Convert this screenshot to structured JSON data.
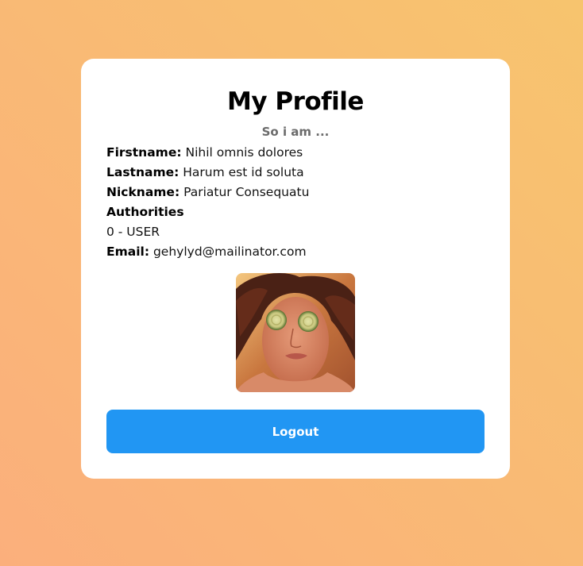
{
  "profile": {
    "title": "My Profile",
    "subtitle": "So i am ...",
    "firstname_label": "Firstname:",
    "firstname_value": "Nihil omnis dolores",
    "lastname_label": "Lastname:",
    "lastname_value": "Harum est id soluta",
    "nickname_label": "Nickname:",
    "nickname_value": "Pariatur Consequatu",
    "authorities_label": "Authorities",
    "authorities": [
      "0 - USER"
    ],
    "email_label": "Email:",
    "email_value": "gehylyd@mailinator.com"
  },
  "actions": {
    "logout_label": "Logout"
  },
  "colors": {
    "background_start": "#fbaf7c",
    "background_end": "#f7c46e",
    "button": "#2196f3"
  }
}
